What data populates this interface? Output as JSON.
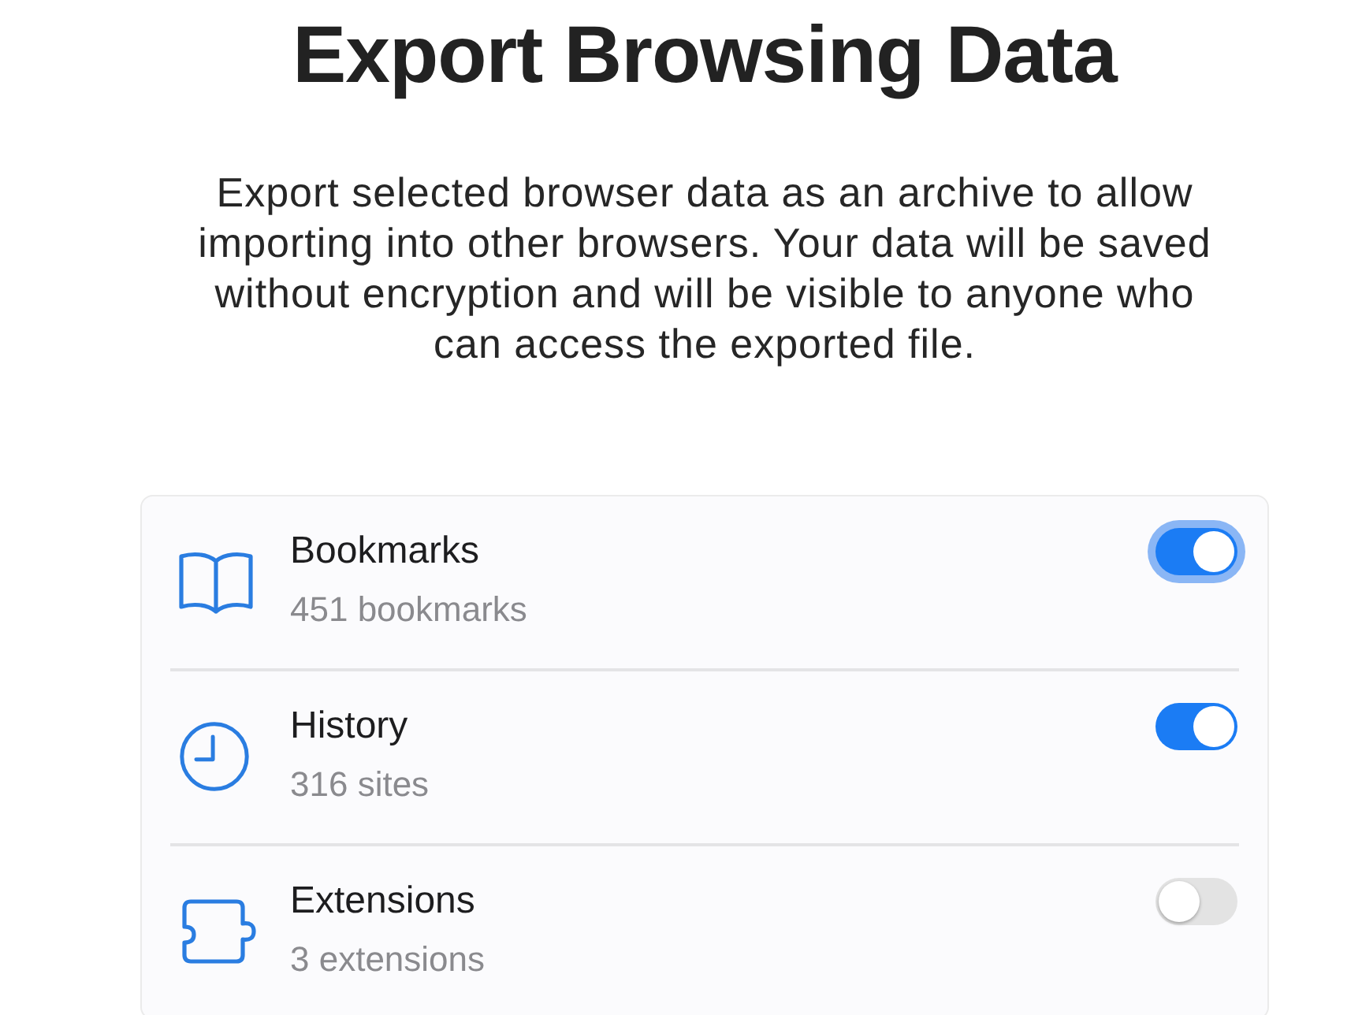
{
  "title": "Export Browsing Data",
  "description": "Export selected browser data as an archive to allow importing into other browsers. Your data will be saved without encryption and will be visible to anyone who can access the exported file.",
  "items": [
    {
      "kind": "bookmarks",
      "label": "Bookmarks",
      "detail": "451 bookmarks",
      "on": true,
      "focused": true
    },
    {
      "kind": "history",
      "label": "History",
      "detail": "316 sites",
      "on": true,
      "focused": false
    },
    {
      "kind": "extensions",
      "label": "Extensions",
      "detail": "3 extensions",
      "on": false,
      "focused": false
    }
  ]
}
